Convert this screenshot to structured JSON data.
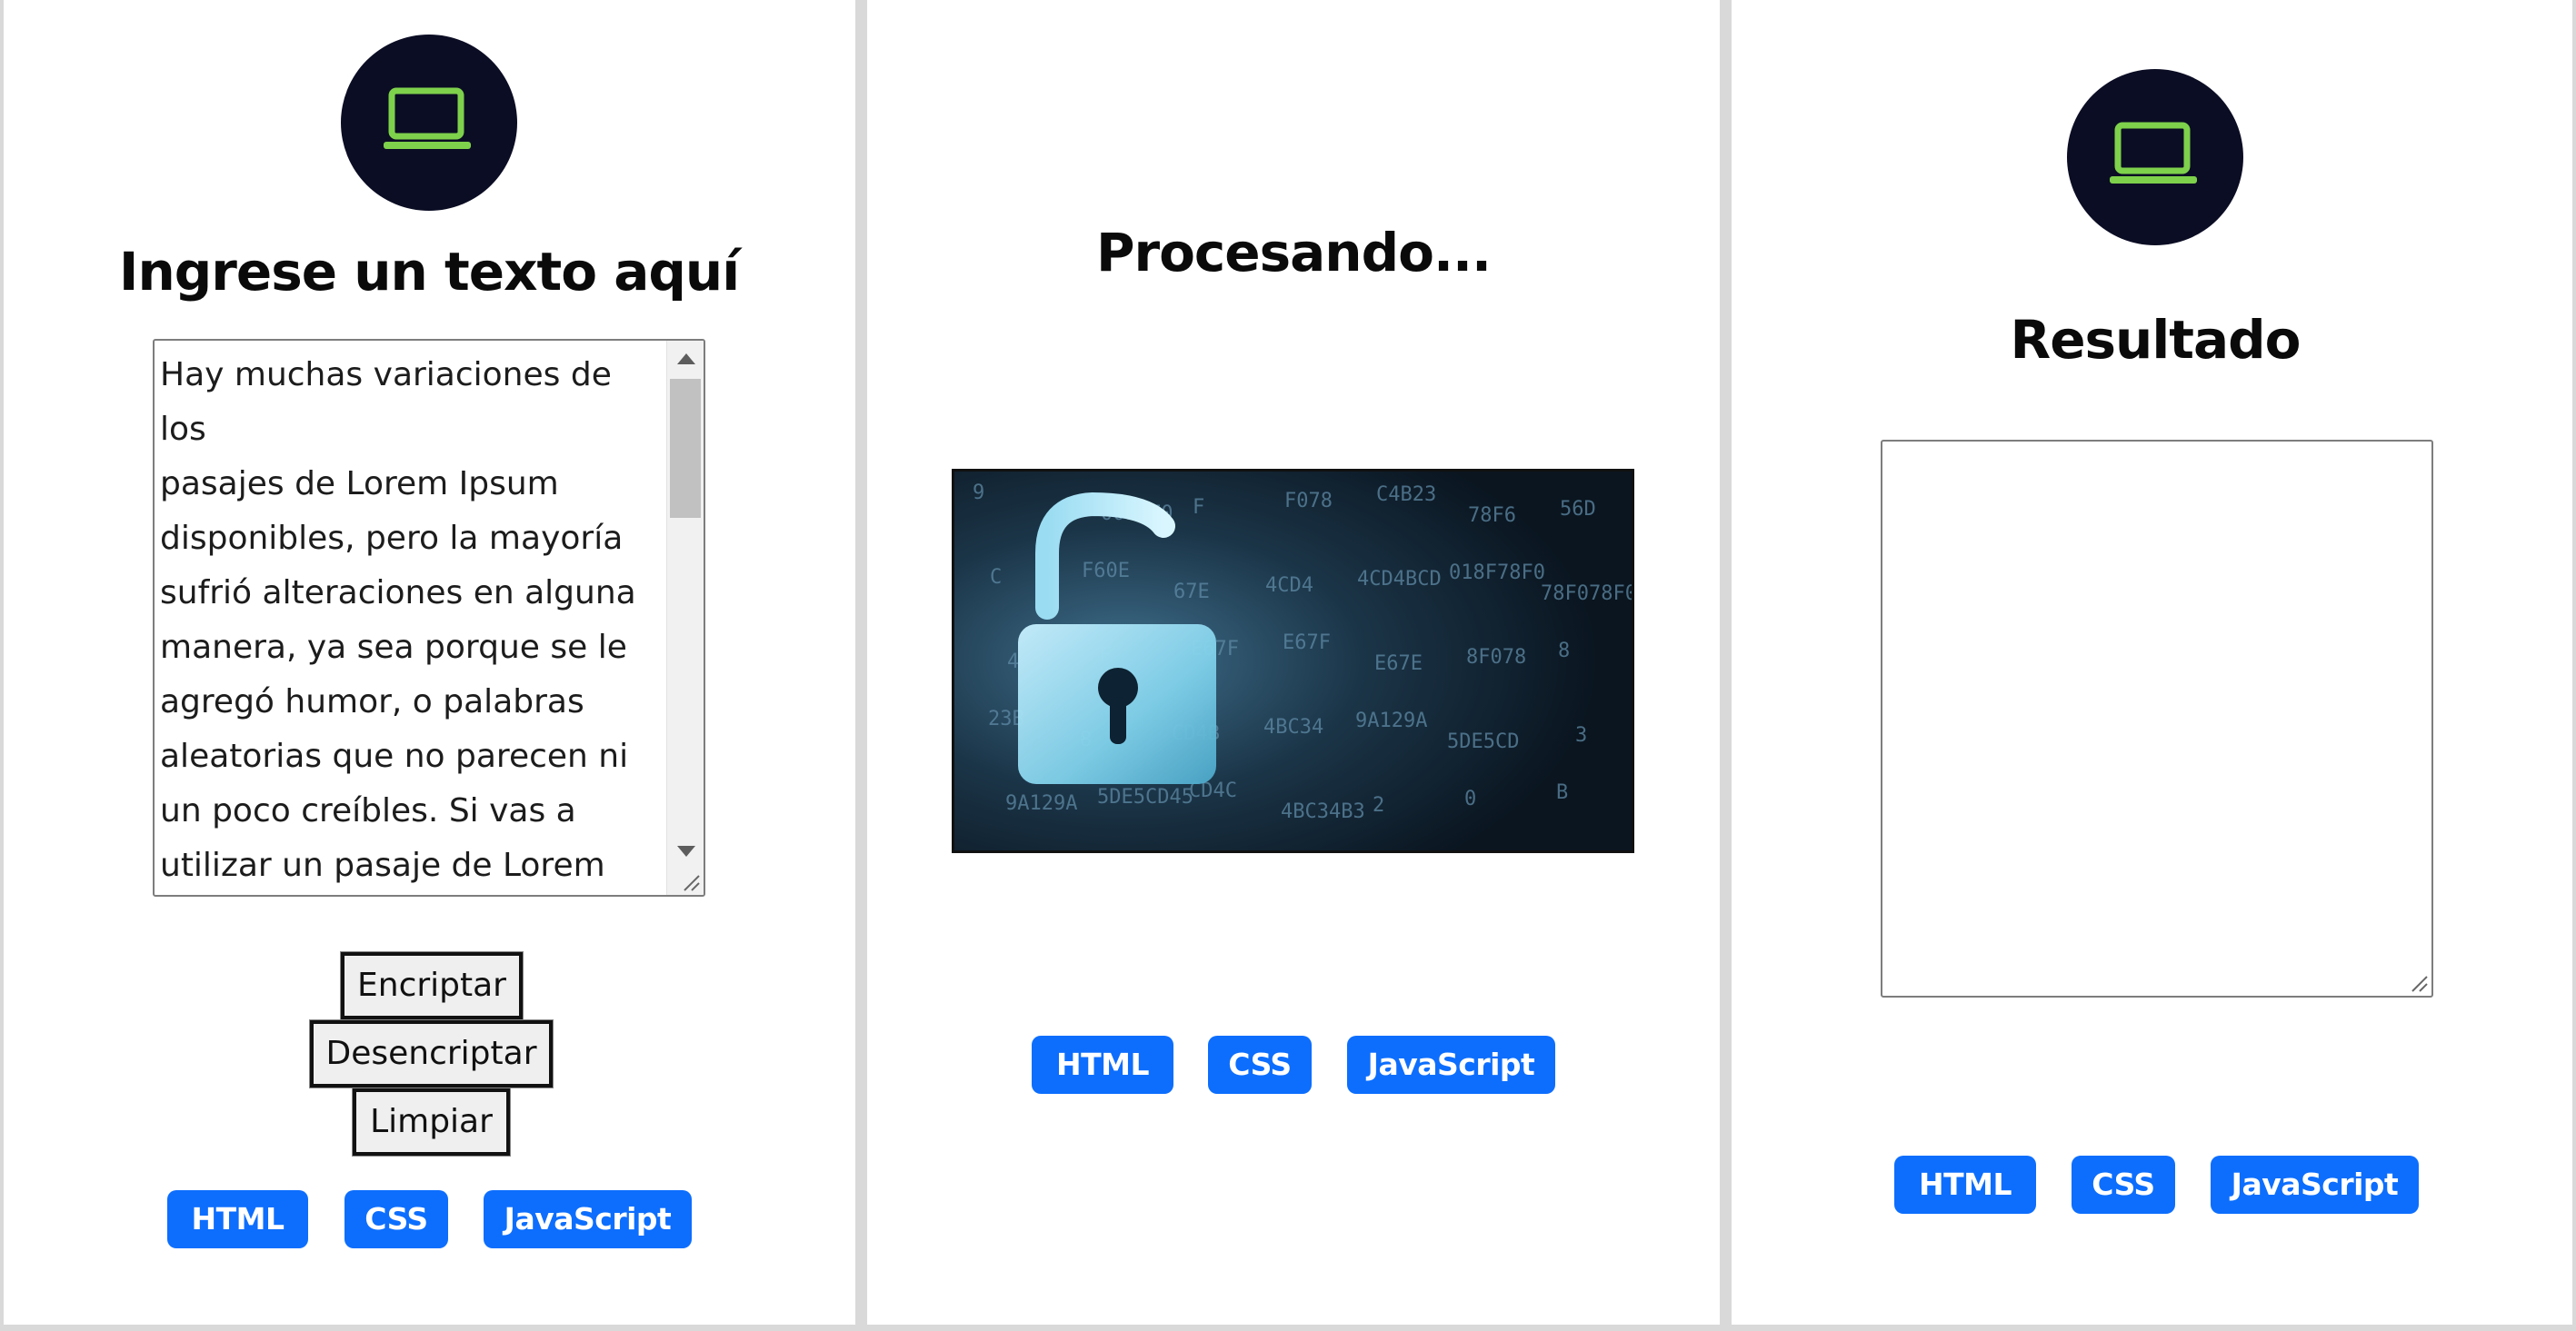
{
  "left": {
    "icon": "laptop-icon",
    "title": "Ingrese un texto aquí",
    "input_text": "Hay muchas variaciones de los\npasajes de Lorem Ipsum\ndisponibles, pero la mayoría\nsufrió alteraciones en alguna\nmanera, ya sea porque se le\nagregó humor, o palabras\naleatorias que no parecen ni\nun poco creíbles. Si vas a\nutilizar un pasaje de Lorem\nIpsum, necesitás estar seguro",
    "buttons": {
      "encrypt": "Encriptar",
      "decrypt": "Desencriptar",
      "clear": "Limpiar"
    },
    "tags": [
      "HTML",
      "CSS",
      "JavaScript"
    ]
  },
  "middle": {
    "title": "Procesando...",
    "image": "unlocked-padlock-over-hex-code",
    "tags": [
      "HTML",
      "CSS",
      "JavaScript"
    ]
  },
  "right": {
    "icon": "laptop-icon",
    "title": "Resultado",
    "output_text": "",
    "tags": [
      "HTML",
      "CSS",
      "JavaScript"
    ]
  },
  "colors": {
    "icon_circle": "#0b0d24",
    "icon_stroke": "#7ed14b",
    "tag_blue": "#0d6efd",
    "divider": "#d9d9d9"
  },
  "hex_glyphs": [
    "9",
    "0018F0",
    "F",
    "F078",
    "C4B23",
    "78F6",
    "56D",
    "C",
    "F60E",
    "67E",
    "4CD4",
    "4CD4BCD",
    "018F78F0",
    "78F078F0",
    "4",
    "F",
    "E67F",
    "E67F",
    "E67E",
    "8F078",
    "8",
    "23B",
    "8",
    "CD4B",
    "4BC34",
    "9A129A",
    "5DE5CD",
    "3",
    "9A129A",
    "5DE5CD45",
    "CD4C",
    "4BC34B3",
    "2",
    "0",
    "B"
  ]
}
